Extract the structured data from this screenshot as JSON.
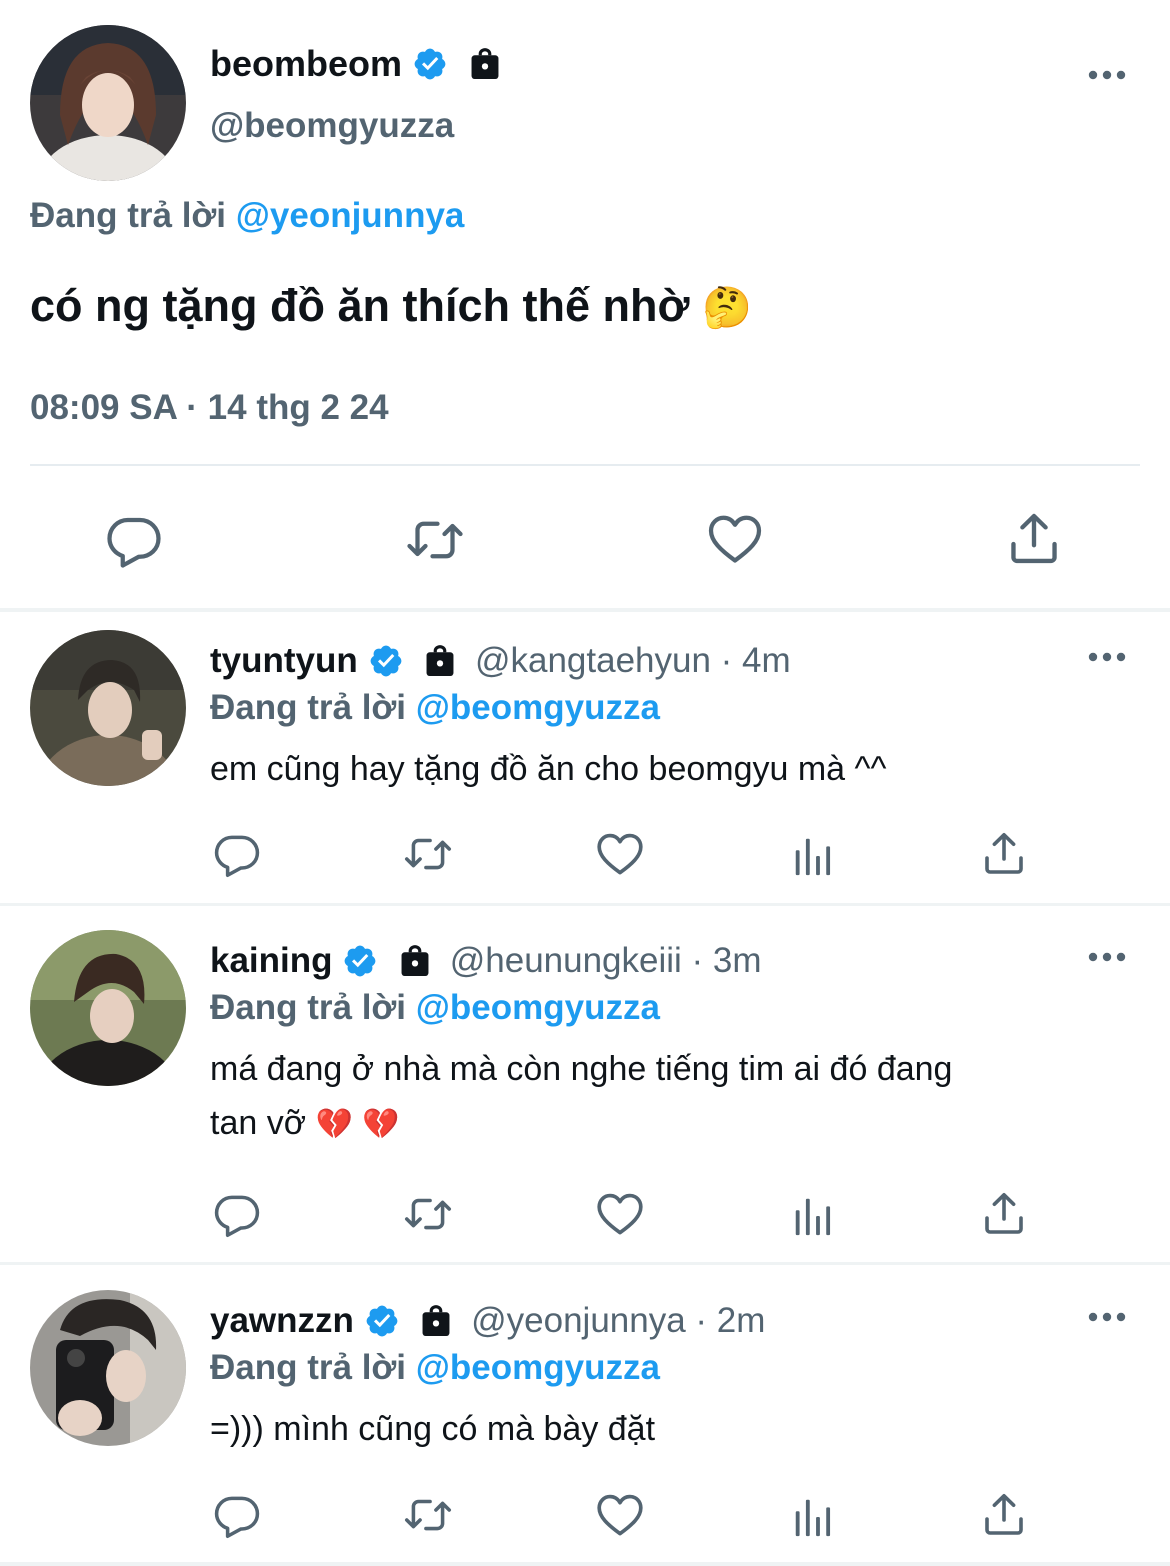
{
  "main_tweet": {
    "display_name": "beombeom",
    "handle": "@beomgyuzza",
    "replying_prefix": "Đang trả lời",
    "replying_to": "@yeonjunnya",
    "text": "có ng tặng đồ ăn thích thế nhờ",
    "emoji": "🤔",
    "timestamp": "08:09 SA · 14 thg 2 24"
  },
  "replies": [
    {
      "display_name": "tyuntyun",
      "meta": "@kangtaehyun · 4m",
      "replying_prefix": "Đang trả lời",
      "replying_to": "@beomgyuzza",
      "text": "em cũng hay tặng đồ ăn cho beomgyu mà ^^"
    },
    {
      "display_name": "kaining",
      "meta": "@heunungkeiii · 3m",
      "replying_prefix": "Đang trả lời",
      "replying_to": "@beomgyuzza",
      "text_line1": "má đang ở nhà mà còn nghe tiếng tim ai đó đang",
      "text_line2": "tan vỡ",
      "emoji": "💔 💔"
    },
    {
      "display_name": "yawnzzn",
      "meta": "@yeonjunnya · 2m",
      "replying_prefix": "Đang trả lời",
      "replying_to": "@beomgyuzza",
      "text": "=))) mình cũng có mà bày đặt"
    }
  ],
  "icons": {
    "verified": "verified-badge-icon",
    "protected": "lock-icon",
    "more": "more-dots-icon",
    "reply": "reply-bubble-icon",
    "retweet": "retweet-icon",
    "like": "heart-icon",
    "analytics": "analytics-bars-icon",
    "share": "share-icon"
  },
  "colors": {
    "accent": "#1d9bf0",
    "text_primary": "#0f1419",
    "text_secondary": "#536471",
    "icon_gray": "#536471"
  }
}
